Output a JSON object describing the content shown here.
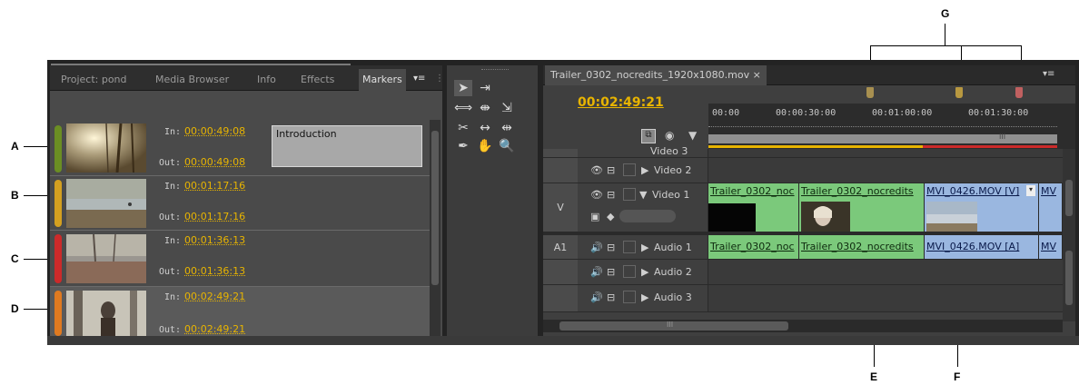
{
  "callouts": {
    "a": "A",
    "b": "B",
    "c": "C",
    "d": "D",
    "e": "E",
    "f": "F",
    "g": "G"
  },
  "project_panel": {
    "tabs": [
      "Project: pond",
      "Media Browser",
      "Info",
      "Effects",
      "Markers"
    ],
    "active_tab": "Markers",
    "markers": [
      {
        "color": "#6b8e23",
        "in_label": "In:",
        "in": "00:00:49:08",
        "out_label": "Out:",
        "out": "00:00:49:08",
        "name": "Introduction"
      },
      {
        "color": "#d4a020",
        "in_label": "In:",
        "in": "00:01:17:16",
        "out_label": "Out:",
        "out": "00:01:17:16",
        "name": ""
      },
      {
        "color": "#cc2a2a",
        "in_label": "In:",
        "in": "00:01:36:13",
        "out_label": "Out:",
        "out": "00:01:36:13",
        "name": ""
      },
      {
        "color": "#e07a20",
        "in_label": "In:",
        "in": "00:02:49:21",
        "out_label": "Out:",
        "out": "00:02:49:21",
        "name": ""
      }
    ]
  },
  "timeline": {
    "tab_title": "Trailer_0302_nocredits_1920x1080.mov ×",
    "playhead_timecode": "00:02:49:21",
    "ruler_labels": [
      "00:00",
      "00:00:30:00",
      "00:01:00:00",
      "00:01:30:00"
    ],
    "ruler_scroll_glyph": "III",
    "marker_colors": [
      "#a89050",
      "#b89840",
      "#c06060"
    ],
    "tracks": {
      "video3": "Video 3",
      "video2": "Video 2",
      "video1": "Video 1",
      "audio1": "Audio 1",
      "audio2": "Audio 2",
      "audio3": "Audio 3",
      "v_id": "V",
      "a1_id": "A1"
    },
    "video_clips": [
      {
        "name": "Trailer_0302_noc",
        "color": "green"
      },
      {
        "name": "Trailer_0302_nocredits",
        "color": "green"
      },
      {
        "name": "MVI_0426.MOV [V]",
        "color": "blue"
      },
      {
        "name": "MV",
        "color": "blue"
      }
    ],
    "audio_clips": [
      {
        "name": "Trailer_0302_noc",
        "color": "green"
      },
      {
        "name": "Trailer_0302_nocredits",
        "color": "green"
      },
      {
        "name": "MVI_0426.MOV [A]",
        "color": "blue"
      },
      {
        "name": "MV",
        "color": "blue"
      }
    ],
    "hscroll_glyph": "III"
  }
}
